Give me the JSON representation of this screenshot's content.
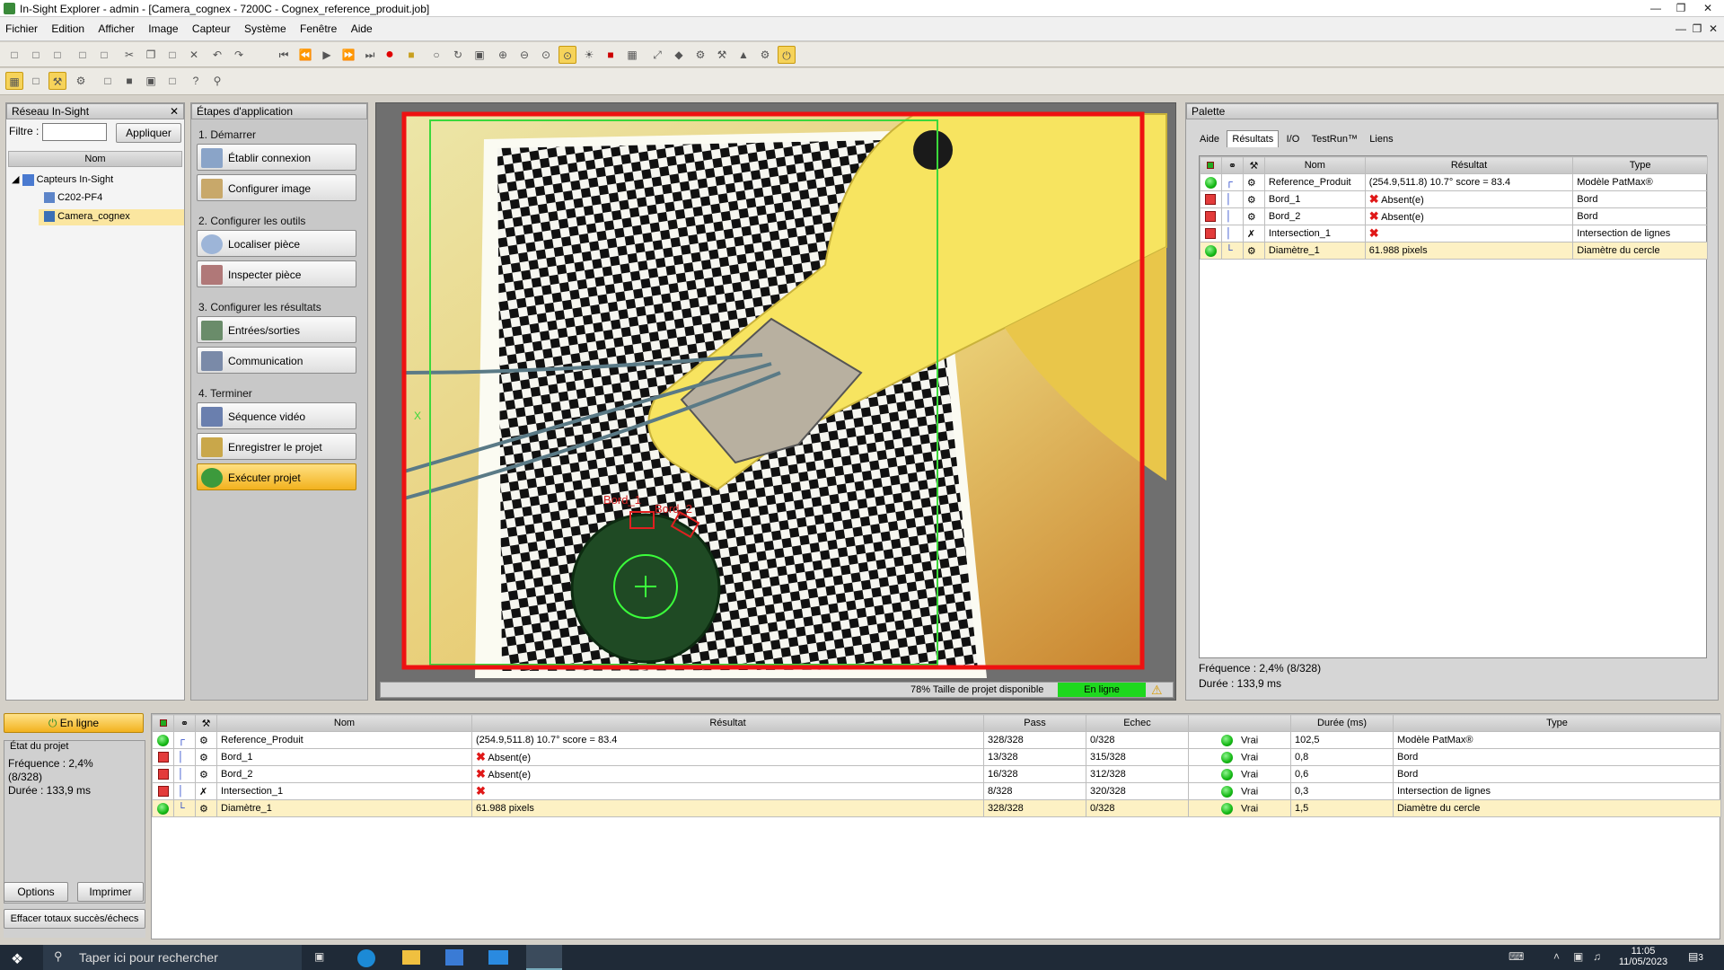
{
  "window": {
    "title": "In-Sight Explorer - admin - [Camera_cognex - 7200C - Cognex_reference_produit.job]"
  },
  "menu": [
    "Fichier",
    "Edition",
    "Afficher",
    "Image",
    "Capteur",
    "Système",
    "Fenêtre",
    "Aide"
  ],
  "network": {
    "title": "Réseau In-Sight",
    "filter_label": "Filtre :",
    "filter_value": "",
    "apply_label": "Appliquer",
    "column": "Nom",
    "tree": {
      "root": "Capteurs In-Sight",
      "child1": "C202-PF4",
      "child2": "Camera_cognex"
    }
  },
  "steps": {
    "title": "Étapes d'application",
    "s1": "1. Démarrer",
    "s1b1": "Établir connexion",
    "s1b2": "Configurer image",
    "s2": "2. Configurer les outils",
    "s2b1": "Localiser pièce",
    "s2b2": "Inspecter pièce",
    "s3": "3. Configurer les résultats",
    "s3b1": "Entrées/sorties",
    "s3b2": "Communication",
    "s4": "4. Terminer",
    "s4b1": "Séquence vidéo",
    "s4b2": "Enregistrer le projet",
    "s4b3": "Exécuter projet"
  },
  "image": {
    "label_bord1": "Bord_1",
    "label_bord2": "Bord_2",
    "axis_x": "X",
    "status_text": "78% Taille de projet disponible",
    "online": "En ligne"
  },
  "palette": {
    "title": "Palette",
    "tabs": [
      "Aide",
      "Résultats",
      "I/O",
      "TestRun™",
      "Liens"
    ],
    "col_nom": "Nom",
    "col_result": "Résultat",
    "col_type": "Type",
    "freq": "Fréquence : 2,4% (8/328)",
    "duration": "Durée : 133,9 ms"
  },
  "results": [
    {
      "name": "Reference_Produit",
      "result": "(254.9,511.8) 10.7° score = 83.4",
      "type": "Modèle PatMax®",
      "ok": true,
      "pass": "328/328",
      "fail": "0/328",
      "vrai": "Vrai",
      "dur": "102,5"
    },
    {
      "name": "Bord_1",
      "result": "Absent(e)",
      "type": "Bord",
      "ok": false,
      "pass": "13/328",
      "fail": "315/328",
      "vrai": "Vrai",
      "dur": "0,8"
    },
    {
      "name": "Bord_2",
      "result": "Absent(e)",
      "type": "Bord",
      "ok": false,
      "pass": "16/328",
      "fail": "312/328",
      "vrai": "Vrai",
      "dur": "0,6"
    },
    {
      "name": "Intersection_1",
      "result": "",
      "type": "Intersection de lignes",
      "ok": false,
      "pass": "8/328",
      "fail": "320/328",
      "vrai": "Vrai",
      "dur": "0,3"
    },
    {
      "name": "Diamètre_1",
      "result": "61.988 pixels",
      "type": "Diamètre du cercle",
      "ok": true,
      "pass": "328/328",
      "fail": "0/328",
      "vrai": "Vrai",
      "dur": "1,5"
    }
  ],
  "bottom": {
    "col_nom": "Nom",
    "col_result": "Résultat",
    "col_pass": "Pass",
    "col_fail": "Echec",
    "col_dur": "Durée (ms)",
    "col_type": "Type"
  },
  "project": {
    "online_btn": "En ligne",
    "state_title": "État du projet",
    "freq1": "Fréquence : 2,4%",
    "freq2": "(8/328)",
    "duration": "Durée : 133,9 ms",
    "options": "Options",
    "print": "Imprimer",
    "clear": "Effacer totaux succès/échecs"
  },
  "taskbar": {
    "search": "Taper ici pour rechercher",
    "time": "11:05",
    "date": "11/05/2023",
    "badge": "3"
  }
}
